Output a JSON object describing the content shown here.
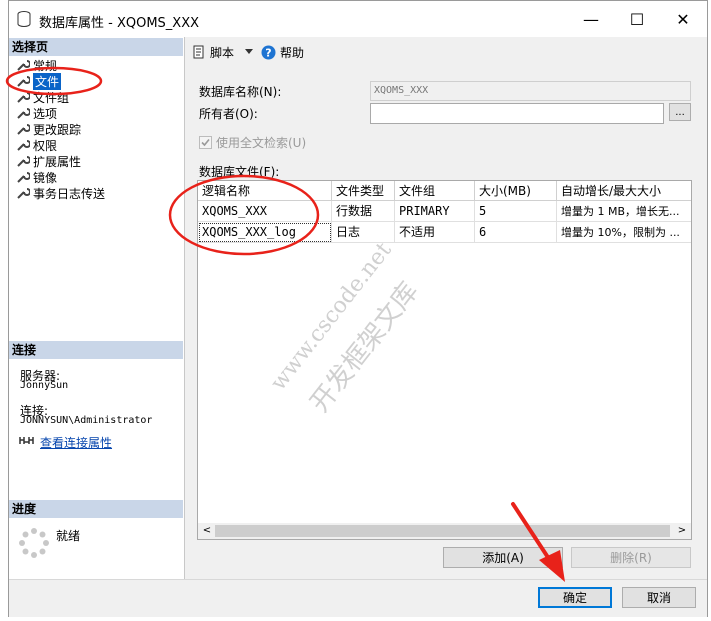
{
  "window": {
    "title": "数据库属性 - XQOMS_XXX",
    "minimize": "—",
    "maximize": "☐",
    "close": "✕"
  },
  "left": {
    "section_select": "选择页",
    "nav": [
      {
        "label": "常规"
      },
      {
        "label": "文件",
        "selected": true
      },
      {
        "label": "文件组"
      },
      {
        "label": "选项"
      },
      {
        "label": "更改跟踪"
      },
      {
        "label": "权限"
      },
      {
        "label": "扩展属性"
      },
      {
        "label": "镜像"
      },
      {
        "label": "事务日志传送"
      }
    ],
    "section_connection": "连接",
    "server_label": "服务器:",
    "server_value": "JonnySun",
    "conn_label": "连接:",
    "conn_value": "JONNYSUN\\Administrator",
    "view_conn_link": "查看连接属性",
    "section_progress": "进度",
    "progress_status": "就绪"
  },
  "toolbar": {
    "script": "脚本",
    "help": "帮助"
  },
  "form": {
    "db_name_label": "数据库名称(N):",
    "db_name_value": "XQOMS_XXX",
    "owner_label": "所有者(O):",
    "owner_value": "",
    "owner_browse": "...",
    "fulltext_label": "使用全文检索(U)",
    "db_files_label": "数据库文件(F):"
  },
  "grid": {
    "columns": [
      "逻辑名称",
      "文件类型",
      "文件组",
      "大小(MB)",
      "自动增长/最大大小"
    ],
    "rows": [
      [
        "XQOMS_XXX",
        "行数据",
        "PRIMARY",
        "5",
        "增量为 1 MB，增长无..."
      ],
      [
        "XQOMS_XXX_log",
        "日志",
        "不适用",
        "6",
        "增量为 10%，限制为 ..."
      ]
    ],
    "scroll_left": "<",
    "scroll_right": ">"
  },
  "buttons": {
    "add": "添加(A)",
    "remove": "删除(R)",
    "ok": "确定",
    "cancel": "取消"
  },
  "watermark": {
    "line1": "www.cscode.net",
    "line2": "开发框架文库"
  },
  "colors": {
    "selection": "#0a64c8",
    "section_header": "#c9d6e8",
    "annotation": "#e8221a",
    "primary_border": "#0078d7"
  }
}
